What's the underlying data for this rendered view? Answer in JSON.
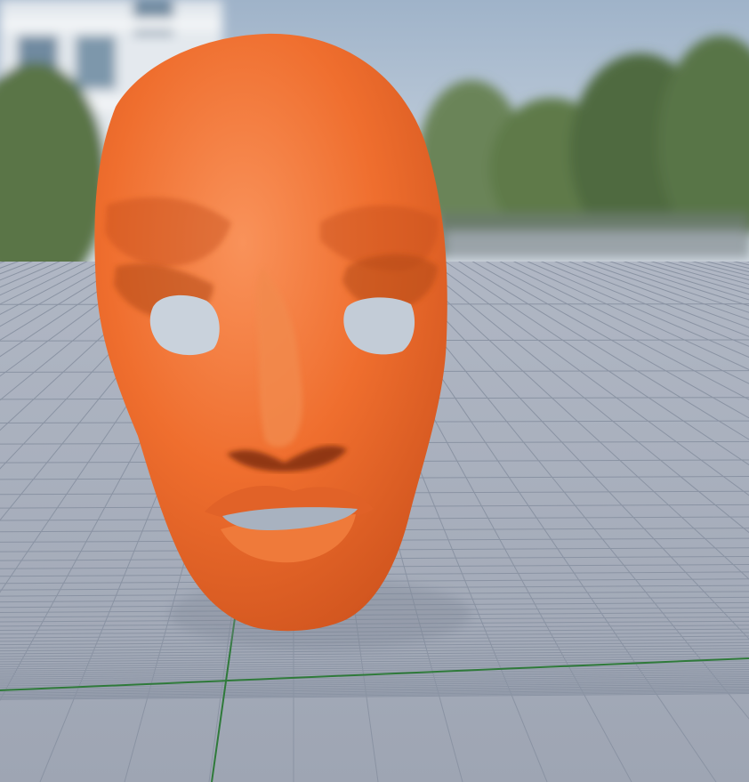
{
  "scene": {
    "colors": {
      "sky_top": "#9fb3c9",
      "sky_horizon": "#d5dde6",
      "foliage": "#5e7a4a",
      "building": "#e4e9ee",
      "ground_near": "#9ea5b3",
      "ground_far": "#b0b7c4",
      "grid_line": "#8a93a3",
      "axis_line": "#2f7a3a",
      "mask": "#ef6e2e",
      "mask_shadow": "#c5501c",
      "mask_highlight": "#f9925a"
    },
    "objects": [
      "sky-backdrop",
      "building",
      "trees",
      "grid-floor",
      "world-axis",
      "orange-face-mask"
    ]
  }
}
